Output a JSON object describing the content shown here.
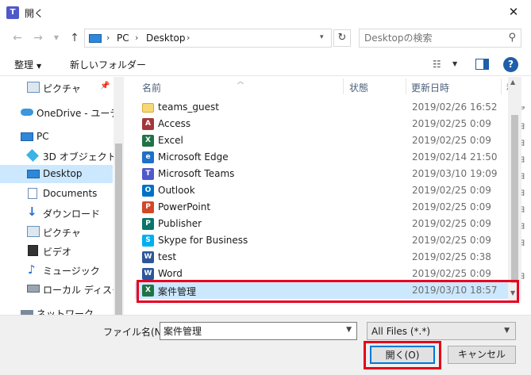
{
  "window": {
    "title": "開く",
    "app_icon": "teams-icon",
    "close_glyph": "✕"
  },
  "address": {
    "crumbs": [
      "PC",
      "Desktop"
    ],
    "search_placeholder": "Desktopの検索"
  },
  "toolbar": {
    "organize": "整理",
    "new_folder": "新しいフォルダー"
  },
  "nav": {
    "items": [
      {
        "label": "ピクチャ",
        "icon": "pictures-icon",
        "pinned": true
      },
      {
        "label": "OneDrive - ユーティ",
        "icon": "onedrive-icon"
      },
      {
        "label": "PC",
        "icon": "pc-icon"
      },
      {
        "label": "3D オブジェクト",
        "icon": "3d-objects-icon"
      },
      {
        "label": "Desktop",
        "icon": "desktop-icon",
        "selected": true
      },
      {
        "label": "Documents",
        "icon": "documents-icon"
      },
      {
        "label": "ダウンロード",
        "icon": "downloads-icon"
      },
      {
        "label": "ピクチャ",
        "icon": "pictures-icon"
      },
      {
        "label": "ビデオ",
        "icon": "videos-icon"
      },
      {
        "label": "ミュージック",
        "icon": "music-icon"
      },
      {
        "label": "ローカル ディスク (C",
        "icon": "local-disk-icon"
      },
      {
        "label": "ネットワーク",
        "icon": "network-icon"
      }
    ]
  },
  "columns": {
    "name": "名前",
    "status": "状態",
    "modified": "更新日時",
    "type": "種"
  },
  "files": [
    {
      "name": "teams_guest",
      "date": "2019/02/26 16:52",
      "type": "ファ",
      "icon": "folder-icon",
      "color": "#f8d775"
    },
    {
      "name": "Access",
      "date": "2019/02/25 0:09",
      "type": "ショ",
      "icon": "access-icon",
      "color": "#a4373a",
      "glyph": "A"
    },
    {
      "name": "Excel",
      "date": "2019/02/25 0:09",
      "type": "ショ",
      "icon": "excel-icon",
      "color": "#217346",
      "glyph": "X"
    },
    {
      "name": "Microsoft Edge",
      "date": "2019/02/14 21:50",
      "type": "ショ",
      "icon": "edge-icon",
      "color": "#1e70c8",
      "glyph": "e"
    },
    {
      "name": "Microsoft Teams",
      "date": "2019/03/10 19:09",
      "type": "ショ",
      "icon": "teams-icon",
      "color": "#5059c9",
      "glyph": "T"
    },
    {
      "name": "Outlook",
      "date": "2019/02/25 0:09",
      "type": "ショ",
      "icon": "outlook-icon",
      "color": "#0072c6",
      "glyph": "O"
    },
    {
      "name": "PowerPoint",
      "date": "2019/02/25 0:09",
      "type": "ショ",
      "icon": "powerpoint-icon",
      "color": "#d24726",
      "glyph": "P"
    },
    {
      "name": "Publisher",
      "date": "2019/02/25 0:09",
      "type": "ショ",
      "icon": "publisher-icon",
      "color": "#077568",
      "glyph": "P"
    },
    {
      "name": "Skype for Business",
      "date": "2019/02/25 0:09",
      "type": "ショ",
      "icon": "skype-icon",
      "color": "#00aff0",
      "glyph": "S"
    },
    {
      "name": "test",
      "date": "2019/02/25 0:38",
      "type": "M",
      "icon": "word-doc-icon",
      "color": "#2b579a",
      "glyph": "W"
    },
    {
      "name": "Word",
      "date": "2019/02/25 0:09",
      "type": "ショ",
      "icon": "word-icon",
      "color": "#2b579a",
      "glyph": "W"
    },
    {
      "name": "案件管理",
      "date": "2019/03/10 18:57",
      "type": "M",
      "icon": "excel-doc-icon",
      "color": "#217346",
      "glyph": "X",
      "selected": true
    }
  ],
  "footer": {
    "filename_label": "ファイル名(N):",
    "filename_value": "案件管理",
    "filetype": "All Files (*.*)",
    "open_button": "開く(O)",
    "cancel_button": "キャンセル"
  }
}
